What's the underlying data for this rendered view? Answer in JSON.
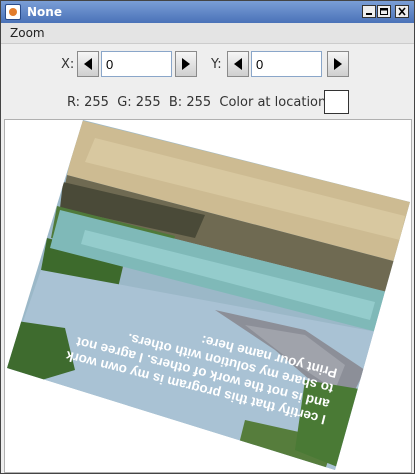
{
  "window": {
    "title": "None"
  },
  "menu": {
    "zoom_label": "Zoom"
  },
  "controls": {
    "x_label": "X:",
    "x_value": "0",
    "y_label": "Y:",
    "y_value": "0",
    "rgb_text": "R: 255  G: 255  B: 255  Color at location:",
    "swatch_color": "#ffffff"
  },
  "image": {
    "text_lines": [
      "I certify that this program is my own work",
      "and is not the work of others. I agree not",
      "to share my solution with others.",
      "Print your name here:"
    ]
  }
}
